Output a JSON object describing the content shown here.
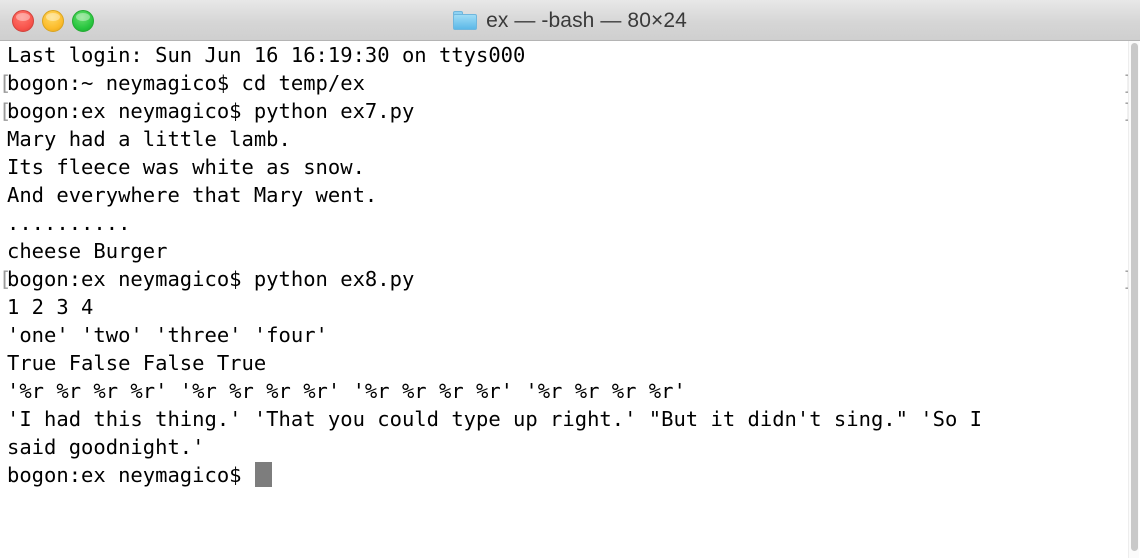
{
  "window": {
    "title": "ex — -bash — 80×24",
    "folder_icon": "folder-icon",
    "controls": {
      "close_label": "close",
      "minimize_label": "minimize",
      "zoom_label": "zoom"
    },
    "colors": {
      "close": "#f8544c",
      "minimize": "#fcbc2c",
      "zoom": "#28c63f",
      "titlebar_bg": "#d6d6d6",
      "terminal_bg": "#ffffff",
      "terminal_fg": "#000000",
      "prompt_mark": "#9a9a9a",
      "cursor": "#7d7d7d",
      "folder": "#5cb8e8"
    }
  },
  "terminal": {
    "cols": 80,
    "rows": 24,
    "shell": "-bash",
    "lines": [
      {
        "text": "Last login: Sun Jun 16 16:19:30 on ttys000",
        "prompt": false
      },
      {
        "text": "bogon:~ neymagico$ cd temp/ex",
        "prompt": true
      },
      {
        "text": "bogon:ex neymagico$ python ex7.py",
        "prompt": true
      },
      {
        "text": "Mary had a little lamb.",
        "prompt": false
      },
      {
        "text": "Its fleece was white as snow.",
        "prompt": false
      },
      {
        "text": "And everywhere that Mary went.",
        "prompt": false
      },
      {
        "text": "..........",
        "prompt": false
      },
      {
        "text": "cheese Burger",
        "prompt": false
      },
      {
        "text": "bogon:ex neymagico$ python ex8.py",
        "prompt": true
      },
      {
        "text": "1 2 3 4",
        "prompt": false
      },
      {
        "text": "'one' 'two' 'three' 'four'",
        "prompt": false
      },
      {
        "text": "True False False True",
        "prompt": false
      },
      {
        "text": "'%r %r %r %r' '%r %r %r %r' '%r %r %r %r' '%r %r %r %r'",
        "prompt": false
      },
      {
        "text": "'I had this thing.' 'That you could type up right.' \"But it didn't sing.\" 'So I",
        "prompt": false
      },
      {
        "text": "said goodnight.'",
        "prompt": false
      }
    ],
    "final_prompt": "bogon:ex neymagico$ ",
    "cursor_visible": true
  },
  "scrollbar": {
    "orientation": "vertical",
    "thumb_position_percent": 100
  }
}
